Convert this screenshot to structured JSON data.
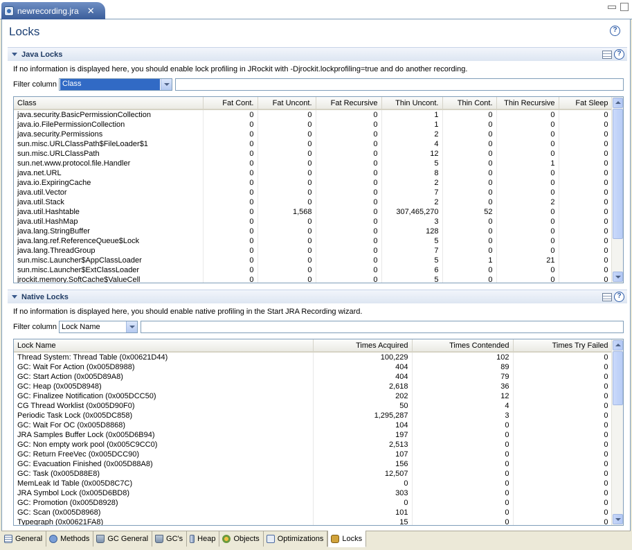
{
  "editor_tab": {
    "label": "newrecording.jra",
    "close": "✕"
  },
  "page_title": "Locks",
  "help_glyph": "?",
  "java_locks": {
    "title": "Java Locks",
    "info": "If no information is displayed here, you should enable lock profiling in JRockit with -Djrockit.lockprofiling=true and do another recording.",
    "filter_label": "Filter column",
    "filter_value": "Class",
    "columns": [
      "Class",
      "Fat Cont.",
      "Fat Uncont.",
      "Fat Recursive",
      "Thin Uncont.",
      "Thin Cont.",
      "Thin Recursive",
      "Fat Sleep"
    ],
    "rows": [
      [
        "java.security.BasicPermissionCollection",
        "0",
        "0",
        "0",
        "1",
        "0",
        "0",
        "0"
      ],
      [
        "java.io.FilePermissionCollection",
        "0",
        "0",
        "0",
        "1",
        "0",
        "0",
        "0"
      ],
      [
        "java.security.Permissions",
        "0",
        "0",
        "0",
        "2",
        "0",
        "0",
        "0"
      ],
      [
        "sun.misc.URLClassPath$FileLoader$1",
        "0",
        "0",
        "0",
        "4",
        "0",
        "0",
        "0"
      ],
      [
        "sun.misc.URLClassPath",
        "0",
        "0",
        "0",
        "12",
        "0",
        "0",
        "0"
      ],
      [
        "sun.net.www.protocol.file.Handler",
        "0",
        "0",
        "0",
        "5",
        "0",
        "1",
        "0"
      ],
      [
        "java.net.URL",
        "0",
        "0",
        "0",
        "8",
        "0",
        "0",
        "0"
      ],
      [
        "java.io.ExpiringCache",
        "0",
        "0",
        "0",
        "2",
        "0",
        "0",
        "0"
      ],
      [
        "java.util.Vector",
        "0",
        "0",
        "0",
        "7",
        "0",
        "0",
        "0"
      ],
      [
        "java.util.Stack",
        "0",
        "0",
        "0",
        "2",
        "0",
        "2",
        "0"
      ],
      [
        "java.util.Hashtable",
        "0",
        "1,568",
        "0",
        "307,465,270",
        "52",
        "0",
        "0"
      ],
      [
        "java.util.HashMap",
        "0",
        "0",
        "0",
        "3",
        "0",
        "0",
        "0"
      ],
      [
        "java.lang.StringBuffer",
        "0",
        "0",
        "0",
        "128",
        "0",
        "0",
        "0"
      ],
      [
        "java.lang.ref.ReferenceQueue$Lock",
        "0",
        "0",
        "0",
        "5",
        "0",
        "0",
        "0"
      ],
      [
        "java.lang.ThreadGroup",
        "0",
        "0",
        "0",
        "7",
        "0",
        "0",
        "0"
      ],
      [
        "sun.misc.Launcher$AppClassLoader",
        "0",
        "0",
        "0",
        "5",
        "1",
        "21",
        "0"
      ],
      [
        "sun.misc.Launcher$ExtClassLoader",
        "0",
        "0",
        "0",
        "6",
        "0",
        "0",
        "0"
      ],
      [
        "jrockit.memory.SoftCache$ValueCell",
        "0",
        "0",
        "0",
        "5",
        "0",
        "0",
        "0"
      ]
    ]
  },
  "native_locks": {
    "title": "Native Locks",
    "info": "If no information is displayed here, you should enable native profiling in the Start JRA Recording wizard.",
    "filter_label": "Filter column",
    "filter_value": "Lock Name",
    "columns": [
      "Lock Name",
      "Times Acquired",
      "Times Contended",
      "Times Try Failed"
    ],
    "rows": [
      [
        "Thread System: Thread Table (0x00621D44)",
        "100,229",
        "102",
        "0"
      ],
      [
        "GC: Wait For Action (0x005D8988)",
        "404",
        "89",
        "0"
      ],
      [
        "GC: Start Action (0x005D89A8)",
        "404",
        "79",
        "0"
      ],
      [
        "GC: Heap (0x005D8948)",
        "2,618",
        "36",
        "0"
      ],
      [
        "GC: Finalizee Notification (0x005DCC50)",
        "202",
        "12",
        "0"
      ],
      [
        "CG Thread Worklist (0x005D90F0)",
        "50",
        "4",
        "0"
      ],
      [
        "Periodic Task Lock (0x005DC858)",
        "1,295,287",
        "3",
        "0"
      ],
      [
        "GC: Wait For OC (0x005D8868)",
        "104",
        "0",
        "0"
      ],
      [
        "JRA Samples Buffer Lock (0x005D6B94)",
        "197",
        "0",
        "0"
      ],
      [
        "GC: Non empty work pool (0x005C9CC0)",
        "2,513",
        "0",
        "0"
      ],
      [
        "GC: Return FreeVec (0x005DCC90)",
        "107",
        "0",
        "0"
      ],
      [
        "GC: Evacuation Finished (0x005D88A8)",
        "156",
        "0",
        "0"
      ],
      [
        "GC: Task (0x005D88E8)",
        "12,507",
        "0",
        "0"
      ],
      [
        "MemLeak Id Table (0x005D8C7C)",
        "0",
        "0",
        "0"
      ],
      [
        "JRA Symbol Lock (0x005D6BD8)",
        "303",
        "0",
        "0"
      ],
      [
        "GC: Promotion (0x005D8928)",
        "0",
        "0",
        "0"
      ],
      [
        "GC: Scan (0x005D8968)",
        "101",
        "0",
        "0"
      ],
      [
        "Typegraph (0x00621FA8)",
        "15",
        "0",
        "0"
      ]
    ]
  },
  "bottom_tabs": [
    {
      "label": "General",
      "icon": "i-table",
      "name": "table-icon"
    },
    {
      "label": "Methods",
      "icon": "i-circle",
      "name": "methods-icon"
    },
    {
      "label": "GC General",
      "icon": "i-bin",
      "name": "trash-can-icon"
    },
    {
      "label": "GC's",
      "icon": "i-bin",
      "name": "trash-can-icon"
    },
    {
      "label": "Heap",
      "icon": "i-heap",
      "name": "heap-icon"
    },
    {
      "label": "Objects",
      "icon": "i-obj",
      "name": "objects-icon"
    },
    {
      "label": "Optimizations",
      "icon": "i-opt",
      "name": "optimizations-icon"
    },
    {
      "label": "Locks",
      "icon": "i-lock",
      "name": "lock-icon",
      "active": true
    }
  ]
}
